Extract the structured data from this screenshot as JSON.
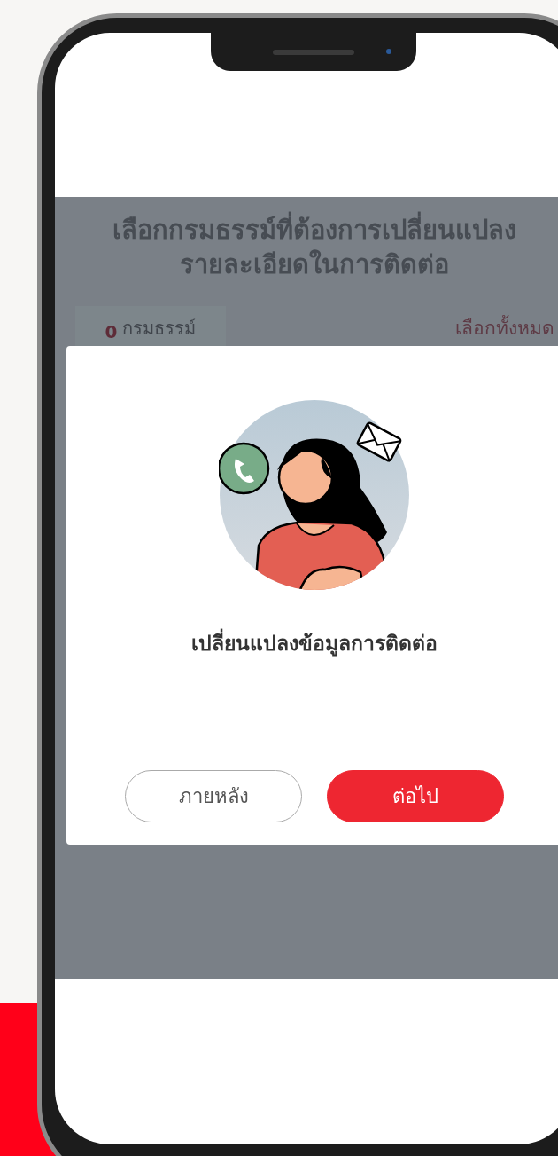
{
  "screen": {
    "heading_lines": [
      "เลือกกรมธรรม์ที่ต้องการเปลี่ยนแปลง",
      "รายละเอียดในการติดต่อ"
    ],
    "policy_count": {
      "count": "0",
      "label": "กรมธรรม์"
    },
    "select_all": "เลือกทั้งหมด"
  },
  "dialog": {
    "title": "เปลี่ยนแปลงข้อมูลการติดต่อ",
    "buttons": [
      {
        "label": "ภายหลัง",
        "kind": "secondary"
      },
      {
        "label": "ต่อไป",
        "kind": "primary"
      }
    ]
  }
}
